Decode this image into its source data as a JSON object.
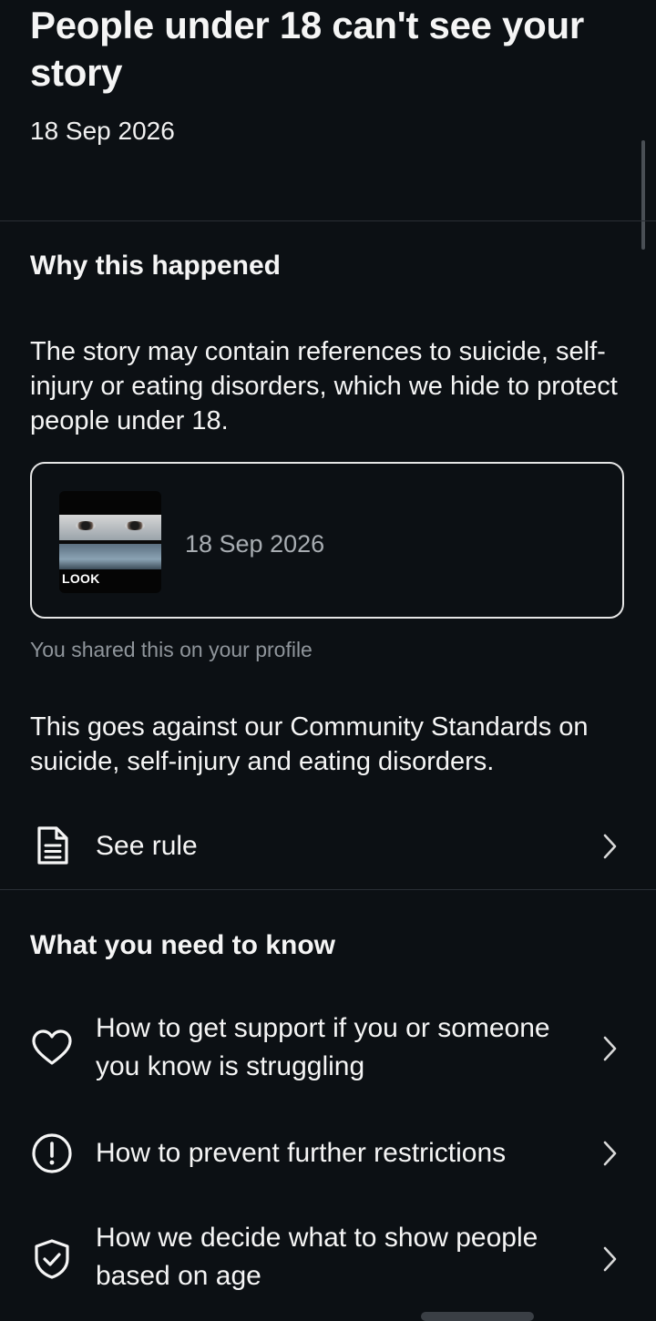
{
  "header": {
    "title": "People under 18 can't see your story",
    "date": "18 Sep 2026"
  },
  "why": {
    "heading": "Why this happened",
    "description": "The story may contain references to suicide, self-injury or eating disorders, which we hide to protect people under 18.",
    "card": {
      "thumbnail_label": "LOOK",
      "date": "18 Sep 2026"
    },
    "shared_note": "You shared this on your profile",
    "standards": "This goes against our Community Standards on suicide, self-injury and eating disorders.",
    "see_rule": "See rule"
  },
  "know": {
    "heading": "What you need to know",
    "items": [
      {
        "label": "How to get support if you or someone you know is struggling",
        "icon": "heart-icon"
      },
      {
        "label": "How to prevent further restrictions",
        "icon": "exclamation-circle-icon"
      },
      {
        "label": "How we decide what to show people based on age",
        "icon": "shield-check-icon"
      }
    ]
  },
  "colors": {
    "background": "#0c1014",
    "text": "#f5f5f5",
    "muted": "#8f959b",
    "divider": "#2a2f35"
  }
}
